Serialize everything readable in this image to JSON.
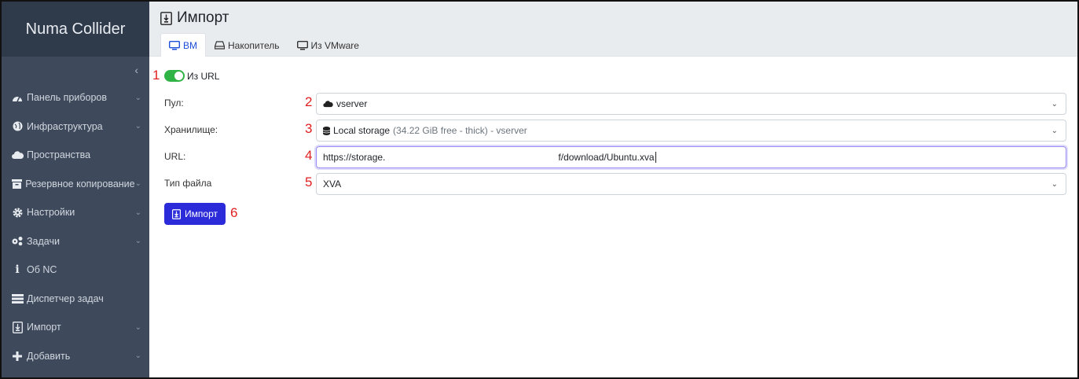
{
  "brand": "Numa Collider",
  "sidebar": {
    "collapse_glyph": "‹",
    "items": [
      {
        "label": "Панель приборов",
        "icon": "dashboard-icon",
        "has_children": true
      },
      {
        "label": "Инфраструктура",
        "icon": "globe-icon",
        "has_children": true
      },
      {
        "label": "Пространства",
        "icon": "cloud-icon",
        "has_children": false
      },
      {
        "label": "Резервное копирование",
        "icon": "archive-icon",
        "has_children": true
      },
      {
        "label": "Настройки",
        "icon": "cog-icon",
        "has_children": true
      },
      {
        "label": "Задачи",
        "icon": "cogs-icon",
        "has_children": true
      },
      {
        "label": "Об NC",
        "icon": "info-icon",
        "has_children": false
      },
      {
        "label": "Диспетчер задач",
        "icon": "tasks-icon",
        "has_children": false
      },
      {
        "label": "Импорт",
        "icon": "file-import-icon",
        "has_children": true
      },
      {
        "label": "Добавить",
        "icon": "plus-icon",
        "has_children": true
      }
    ]
  },
  "header": {
    "title": "Импорт",
    "tabs": [
      {
        "label": "ВМ",
        "active": true,
        "icon": "desktop-icon"
      },
      {
        "label": "Накопитель",
        "active": false,
        "icon": "hdd-icon"
      },
      {
        "label": "Из VMware",
        "active": false,
        "icon": "desktop-icon"
      }
    ]
  },
  "form": {
    "from_url_label": "Из URL",
    "from_url_enabled": true,
    "pool_label": "Пул:",
    "pool_value": "vserver",
    "storage_label": "Хранилище:",
    "storage_name": "Local storage",
    "storage_detail": "(34.22 GiB free - thick) - vserver",
    "url_label": "URL:",
    "url_value": "https://storage.                                                                  f/download/Ubuntu.xva",
    "filetype_label": "Тип файла",
    "filetype_value": "XVA",
    "submit_label": "Импорт"
  },
  "markers": [
    "1",
    "2",
    "3",
    "4",
    "5",
    "6"
  ],
  "colors": {
    "sidebar_bg": "#3e4a5c",
    "brand_bg": "#2f3a4b",
    "toggle_on": "#2fb344",
    "primary": "#2b2bd9",
    "marker": "#e02020"
  }
}
